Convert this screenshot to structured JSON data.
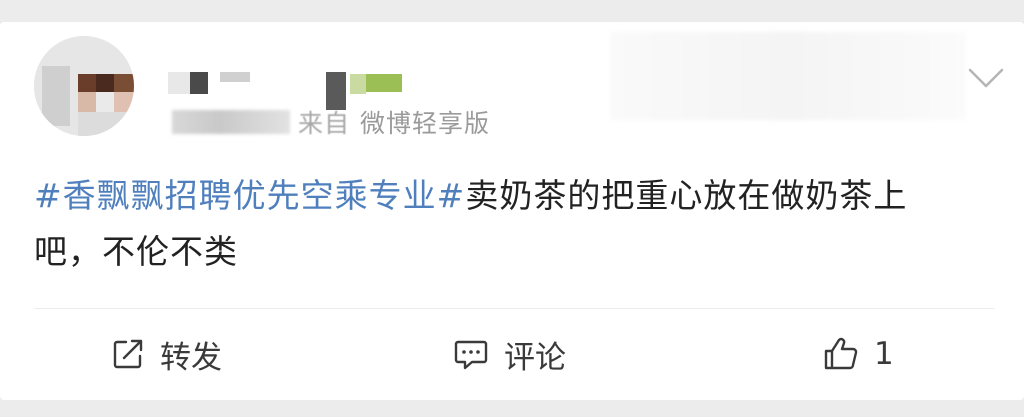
{
  "post": {
    "source_prefix": "来自",
    "source_client": "微博轻享版",
    "topic": "#香飘飘招聘优先空乘专业#",
    "text_line1": "卖奶茶的把重心放在做奶茶上",
    "text_line2": "吧，不伦不类"
  },
  "actions": {
    "repost_label": "转发",
    "comment_label": "评论",
    "like_count": "1"
  },
  "icons": {
    "more": "chevron-down-icon",
    "repost": "share-box-icon",
    "comment": "chat-bubble-icon",
    "like": "thumbs-up-icon"
  },
  "colors": {
    "topic": "#4f7fbd",
    "text": "#222222",
    "muted": "#9a9a9a",
    "background": "#ececec",
    "card": "#ffffff"
  }
}
